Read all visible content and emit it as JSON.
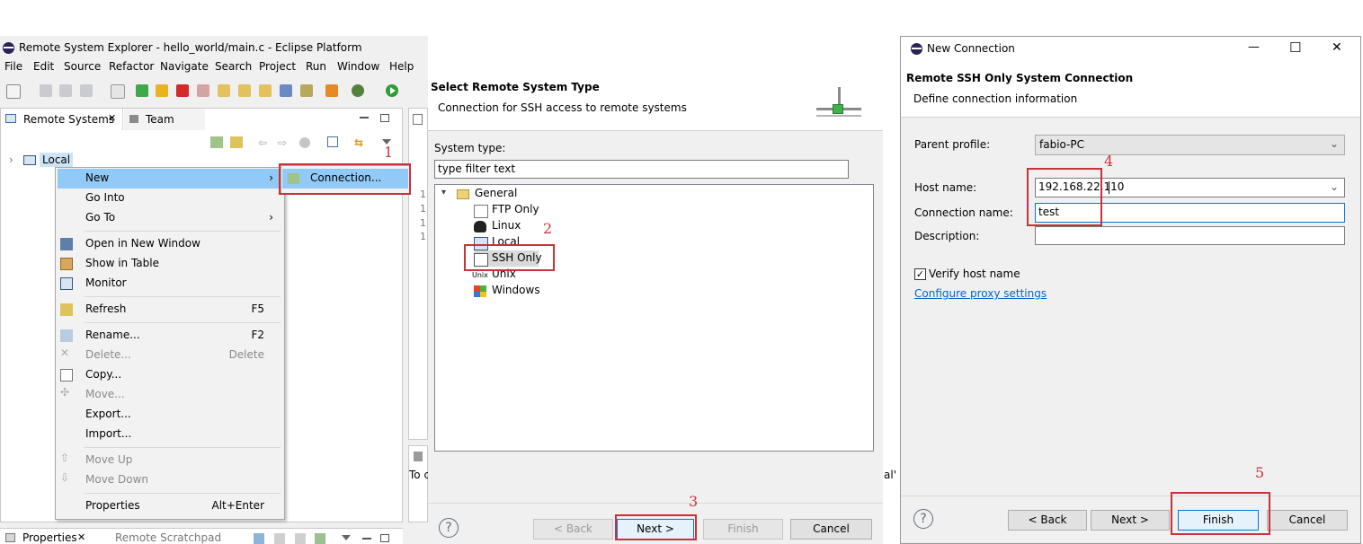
{
  "eclipse": {
    "title": "Remote System Explorer - hello_world/main.c - Eclipse Platform",
    "menu": [
      "File",
      "Edit",
      "Source",
      "Refactor",
      "Navigate",
      "Search",
      "Project",
      "Run",
      "Window",
      "Help"
    ],
    "views": {
      "tab_remote": "Remote Systems",
      "tab_team": "Team",
      "tree_local": "Local",
      "bottom_tab_properties": "Properties",
      "bottom_tab_scratchpad": "Remote Scratchpad"
    },
    "editor_lines": [
      "1",
      "1",
      "1",
      "1"
    ],
    "right_fragment": "To c",
    "right_fragment2": "al' f"
  },
  "context_menu": {
    "items": [
      {
        "label": "New",
        "shortcut": "›",
        "icon": "",
        "disabled": false
      },
      {
        "label": "Go Into",
        "shortcut": "",
        "icon": "",
        "disabled": false
      },
      {
        "label": "Go To",
        "shortcut": "›",
        "icon": "",
        "disabled": false
      },
      {
        "label": "Open in New Window",
        "shortcut": "",
        "icon": "window-icon",
        "disabled": false
      },
      {
        "label": "Show in Table",
        "shortcut": "",
        "icon": "table-icon",
        "disabled": false
      },
      {
        "label": "Monitor",
        "shortcut": "",
        "icon": "monitor-icon",
        "disabled": false
      },
      {
        "label": "Refresh",
        "shortcut": "F5",
        "icon": "refresh-icon",
        "disabled": false
      },
      {
        "label": "Rename...",
        "shortcut": "F2",
        "icon": "rename-icon",
        "disabled": false
      },
      {
        "label": "Delete...",
        "shortcut": "Delete",
        "icon": "delete-icon",
        "disabled": true
      },
      {
        "label": "Copy...",
        "shortcut": "",
        "icon": "copy-icon",
        "disabled": false
      },
      {
        "label": "Move...",
        "shortcut": "",
        "icon": "move-icon",
        "disabled": true
      },
      {
        "label": "Export...",
        "shortcut": "",
        "icon": "",
        "disabled": false
      },
      {
        "label": "Import...",
        "shortcut": "",
        "icon": "",
        "disabled": false
      },
      {
        "label": "Move Up",
        "shortcut": "",
        "icon": "arrow-up-icon",
        "disabled": true
      },
      {
        "label": "Move Down",
        "shortcut": "",
        "icon": "arrow-down-icon",
        "disabled": true
      },
      {
        "label": "Properties",
        "shortcut": "Alt+Enter",
        "icon": "",
        "disabled": false
      }
    ],
    "submenu_connection": "Connection..."
  },
  "wizard": {
    "heading": "Select Remote System Type",
    "description": "Connection for SSH access to remote systems",
    "system_type_label": "System type:",
    "filter_value": "type filter text",
    "tree": {
      "group": "General",
      "items": [
        "FTP Only",
        "Linux",
        "Local",
        "SSH Only",
        "Unix",
        "Windows"
      ],
      "selected": "SSH Only"
    },
    "unix_glyph": "Unix",
    "buttons": {
      "back": "< Back",
      "next": "Next >",
      "finish": "Finish",
      "cancel": "Cancel"
    },
    "help": "?"
  },
  "new_connection": {
    "window_title": "New Connection",
    "heading": "Remote SSH Only System Connection",
    "description": "Define connection information",
    "parent_profile_label": "Parent profile:",
    "parent_profile_value": "fabio-PC",
    "host_name_label": "Host name:",
    "host_name_value": "192.168.22.110",
    "connection_name_label": "Connection name:",
    "connection_name_value": "test",
    "description_label": "Description:",
    "description_value": "",
    "verify_label": "Verify host name",
    "verify_checked": true,
    "proxy_link": "Configure proxy settings",
    "buttons": {
      "back": "< Back",
      "next": "Next >",
      "finish": "Finish",
      "cancel": "Cancel"
    },
    "help": "?",
    "controls": {
      "minimize": "—",
      "maximize": "☐",
      "close": "✕"
    }
  },
  "annotations": [
    "1",
    "2",
    "3",
    "4",
    "5"
  ],
  "colors": {
    "highlight": "#99c9ef",
    "annotation": "#c7323a",
    "link": "#0066cc"
  }
}
